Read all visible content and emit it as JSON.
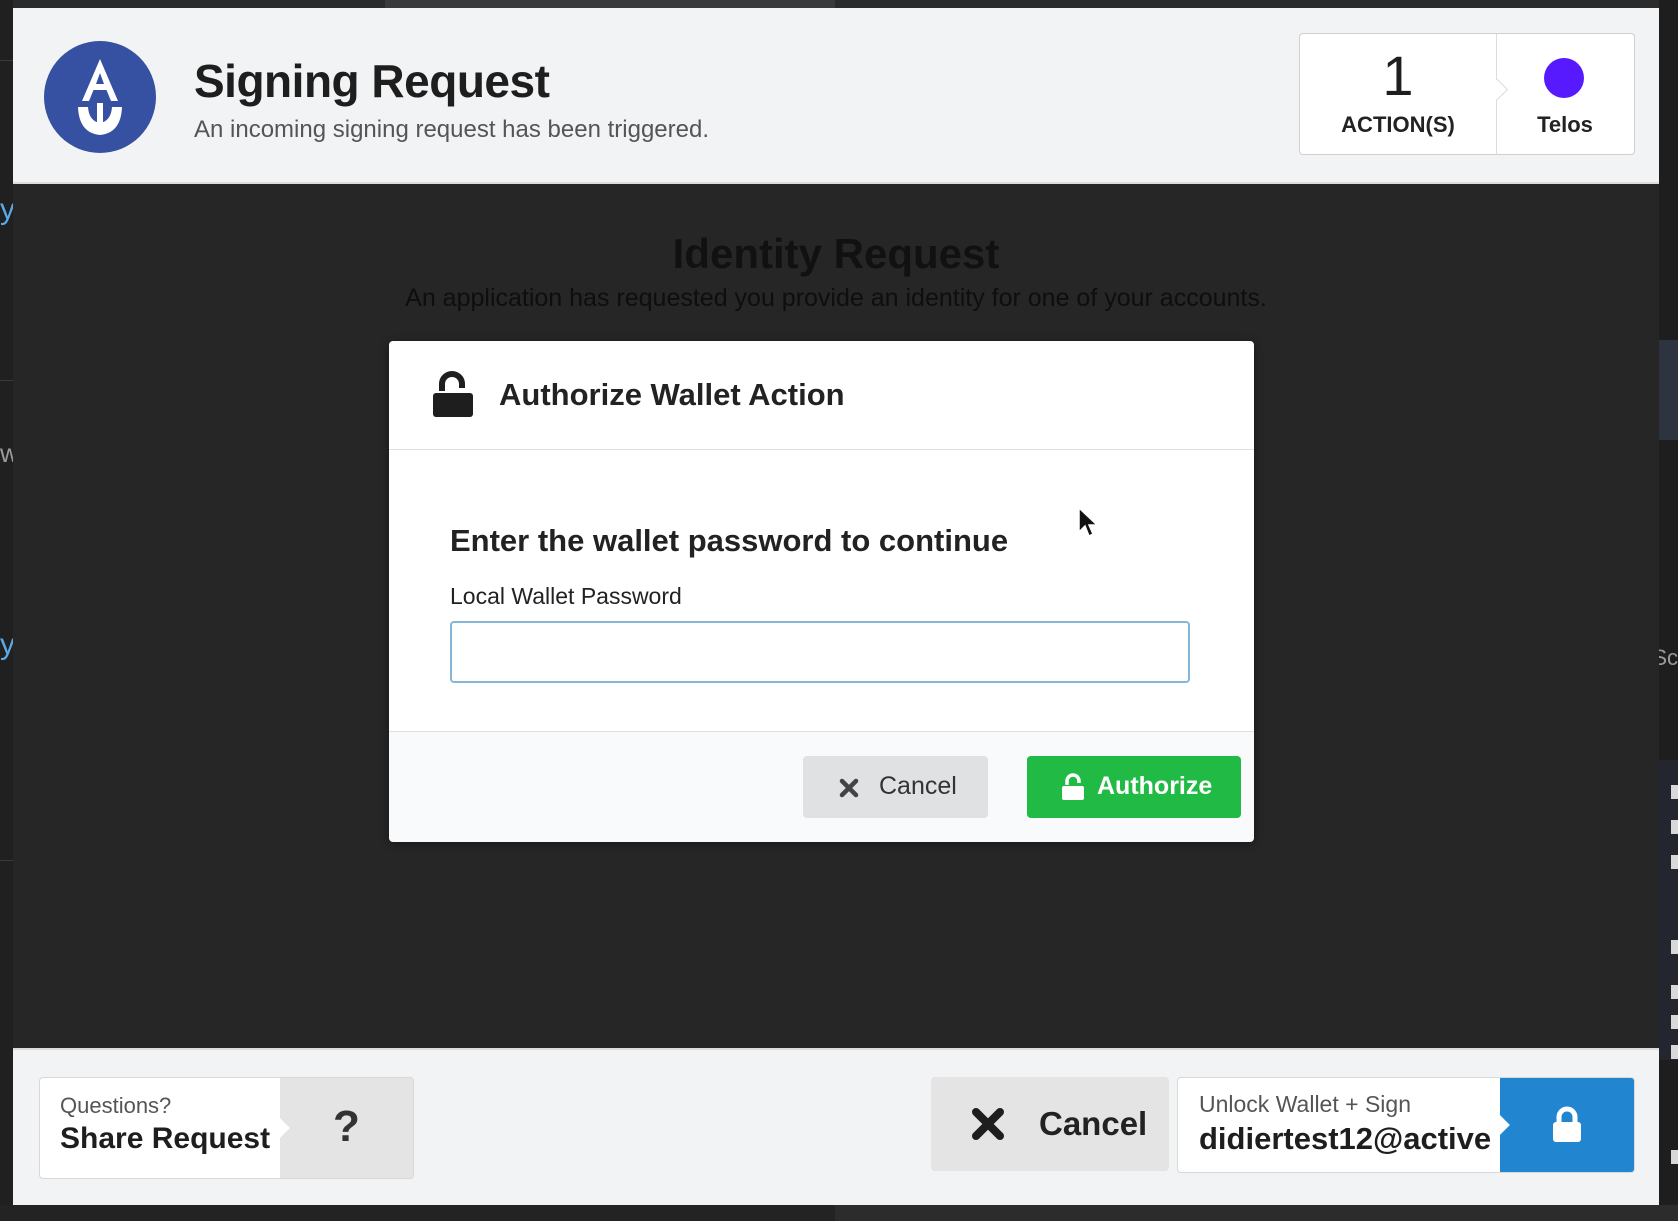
{
  "header": {
    "title": "Signing Request",
    "subtitle": "An incoming signing request has been triggered.",
    "action_count": "1",
    "action_label": "ACTION(S)",
    "chain_name": "Telos",
    "chain_color": "#571aff",
    "logo_icon": "anchor-logo-icon"
  },
  "request": {
    "title": "Identity Request",
    "description": "An application has requested you provide an identity for one of your accounts."
  },
  "modal": {
    "title": "Authorize Wallet Action",
    "prompt": "Enter the wallet password to continue",
    "password_label": "Local Wallet Password",
    "password_value": "",
    "cancel_label": "Cancel",
    "authorize_label": "Authorize"
  },
  "footer": {
    "help_question": "Questions?",
    "help_action": "Share Request",
    "help_icon": "?",
    "cancel_label": "Cancel",
    "sign_label": "Unlock Wallet + Sign",
    "sign_account": "didiertest12@active"
  },
  "background": {
    "left_letters": [
      "y",
      "w",
      "y"
    ],
    "right_text": "Sc"
  },
  "colors": {
    "anchor_blue": "#3650a2",
    "authorize_green": "#21ba45",
    "sign_blue": "#2185d0"
  }
}
